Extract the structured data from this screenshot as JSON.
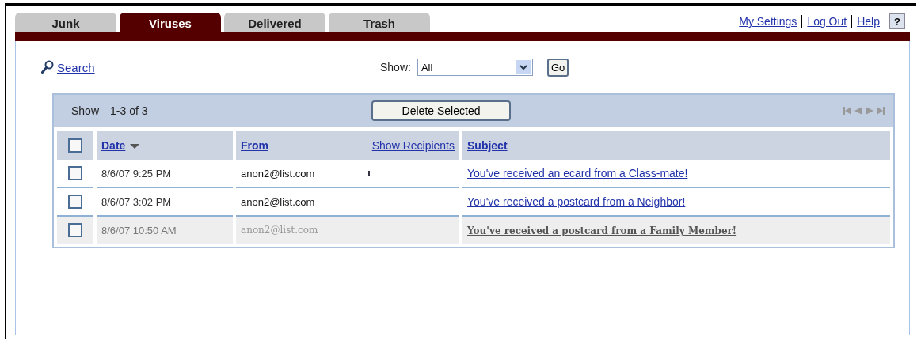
{
  "tabs": [
    {
      "label": "Junk",
      "selected": false
    },
    {
      "label": "Viruses",
      "selected": true
    },
    {
      "label": "Delivered",
      "selected": false
    },
    {
      "label": "Trash",
      "selected": false
    }
  ],
  "top_links": [
    "My Settings",
    "Log Out",
    "Help"
  ],
  "help_button": "?",
  "search_link": "Search",
  "filter": {
    "label": "Show:",
    "value": "All",
    "go": "Go"
  },
  "panel": {
    "show_label": "Show",
    "range": "1-3 of 3",
    "delete_button": "Delete Selected"
  },
  "table": {
    "columns": [
      "Date",
      "From",
      "Show Recipients",
      "Subject"
    ],
    "select_all": {
      "checked": false
    },
    "rows": [
      {
        "checked": false,
        "date": "8/6/07 9:25 PM",
        "from": "anon2@list.com",
        "recipients_marker": true,
        "subject": "You've received an ecard from a Class-mate!",
        "dimmed": false
      },
      {
        "checked": false,
        "date": "8/6/07 3:02 PM",
        "from": "anon2@list.com",
        "recipients_marker": false,
        "subject": "You've received a postcard from a Neighbor!",
        "dimmed": false
      },
      {
        "checked": false,
        "date": "8/6/07 10:50 AM",
        "from": "anon2@list.com",
        "recipients_marker": false,
        "subject": "You've received a postcard from a Family Member!",
        "dimmed": true
      }
    ]
  }
}
